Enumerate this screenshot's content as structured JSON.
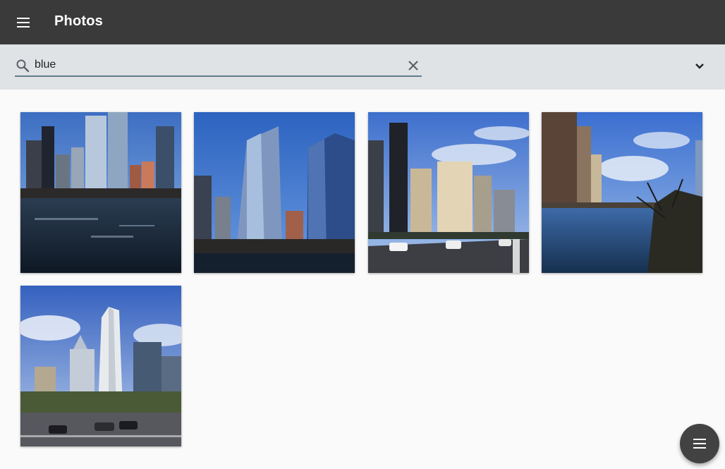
{
  "app": {
    "title": "Photos"
  },
  "search": {
    "value": "blue",
    "placeholder": ""
  },
  "icons": {
    "menu": "menu-icon",
    "search": "search-icon",
    "clear": "close-icon",
    "expand": "chevron-down-icon",
    "fab": "list-icon"
  },
  "colors": {
    "appbar": "#3a3a3a",
    "searchbar": "#dfe3e6",
    "search_underline": "#607d8b",
    "fab": "#424242"
  },
  "photos": [
    {
      "name": "photo-1",
      "subject": "city-river-towers"
    },
    {
      "name": "photo-2",
      "subject": "glass-skyscrapers"
    },
    {
      "name": "photo-3",
      "subject": "street-with-cars"
    },
    {
      "name": "photo-4",
      "subject": "river-and-trees"
    },
    {
      "name": "photo-5",
      "subject": "white-tower-street"
    }
  ]
}
